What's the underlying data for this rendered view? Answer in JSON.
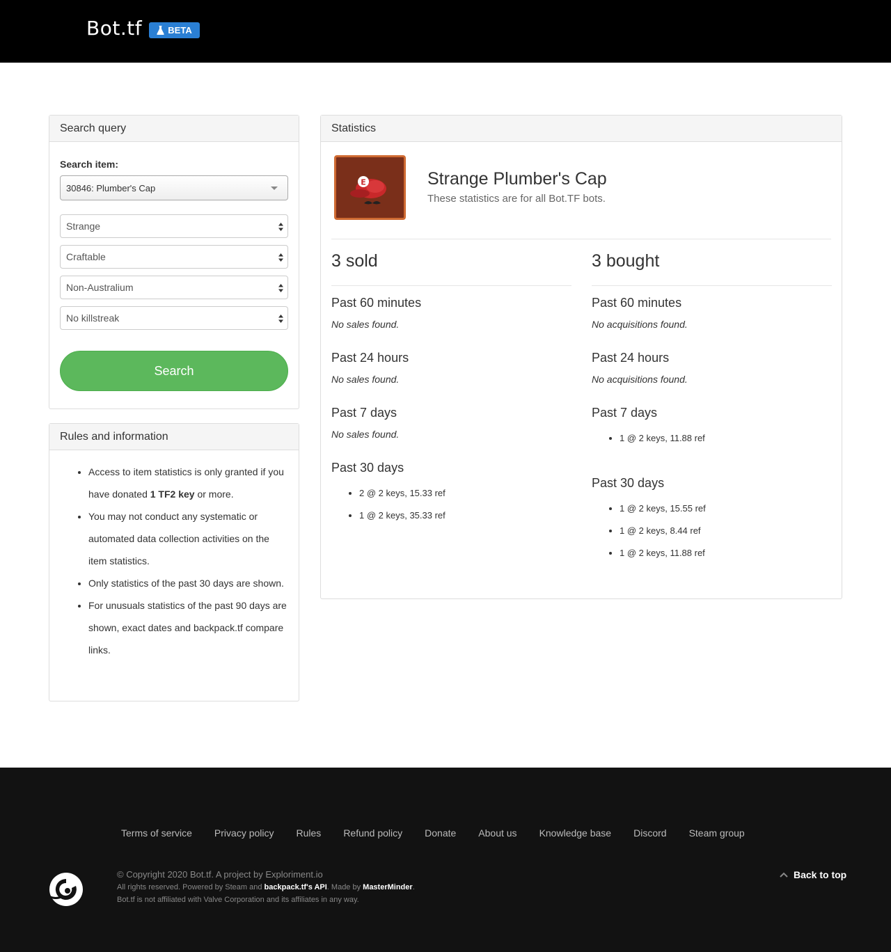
{
  "nav": {
    "brand": "Bot.tf",
    "badge": "BETA"
  },
  "search": {
    "heading": "Search query",
    "label": "Search item:",
    "item": "30846: Plumber's Cap",
    "quality": "Strange",
    "craftable": "Craftable",
    "australium": "Non-Australium",
    "killstreak": "No killstreak",
    "button": "Search"
  },
  "rules": {
    "heading": "Rules and information",
    "r1_a": "Access to item statistics is only granted if you have donated ",
    "r1_b": "1 TF2 key",
    "r1_c": " or more.",
    "r2": "You may not conduct any systematic or automated data collection activities on the item statistics.",
    "r3": "Only statistics of the past 30 days are shown.",
    "r4": "For unusuals statistics of the past 90 days are shown, exact dates and backpack.tf compare links."
  },
  "stats": {
    "heading": "Statistics",
    "item_name": "Strange Plumber's Cap",
    "subtitle": "These statistics are for all Bot.TF bots.",
    "sold": {
      "title": "3 sold",
      "p60": "Past 60 minutes",
      "p60_none": "No sales found.",
      "p24": "Past 24 hours",
      "p24_none": "No sales found.",
      "p7": "Past 7 days",
      "p7_none": "No sales found.",
      "p30": "Past 30 days",
      "p30_items": [
        "2 @ 2 keys, 15.33 ref",
        "1 @ 2 keys, 35.33 ref"
      ]
    },
    "bought": {
      "title": "3 bought",
      "p60": "Past 60 minutes",
      "p60_none": "No acquisitions found.",
      "p24": "Past 24 hours",
      "p24_none": "No acquisitions found.",
      "p7": "Past 7 days",
      "p7_items": [
        "1 @ 2 keys, 11.88 ref"
      ],
      "p30": "Past 30 days",
      "p30_items": [
        "1 @ 2 keys, 15.55 ref",
        "1 @ 2 keys, 8.44 ref",
        "1 @ 2 keys, 11.88 ref"
      ]
    }
  },
  "footer": {
    "links": [
      "Terms of service",
      "Privacy policy",
      "Rules",
      "Refund policy",
      "Donate",
      "About us",
      "Knowledge base",
      "Discord",
      "Steam group"
    ],
    "copyright": "© Copyright 2020 Bot.tf. A project by Exploriment.io",
    "rights_a": "All rights reserved. Powered by Steam and ",
    "rights_b": "backpack.tf's API",
    "rights_c": ". Made by ",
    "rights_d": "MasterMinder",
    "rights_e": ".",
    "disclaimer": "Bot.tf is not affiliated with Valve Corporation and its affiliates in any way.",
    "back_to_top": "Back to top"
  },
  "colors": {
    "accent": "#2a7fd4",
    "search_button": "#5cb85c",
    "item_border": "#cf6a32",
    "footer_bg": "#121212"
  }
}
